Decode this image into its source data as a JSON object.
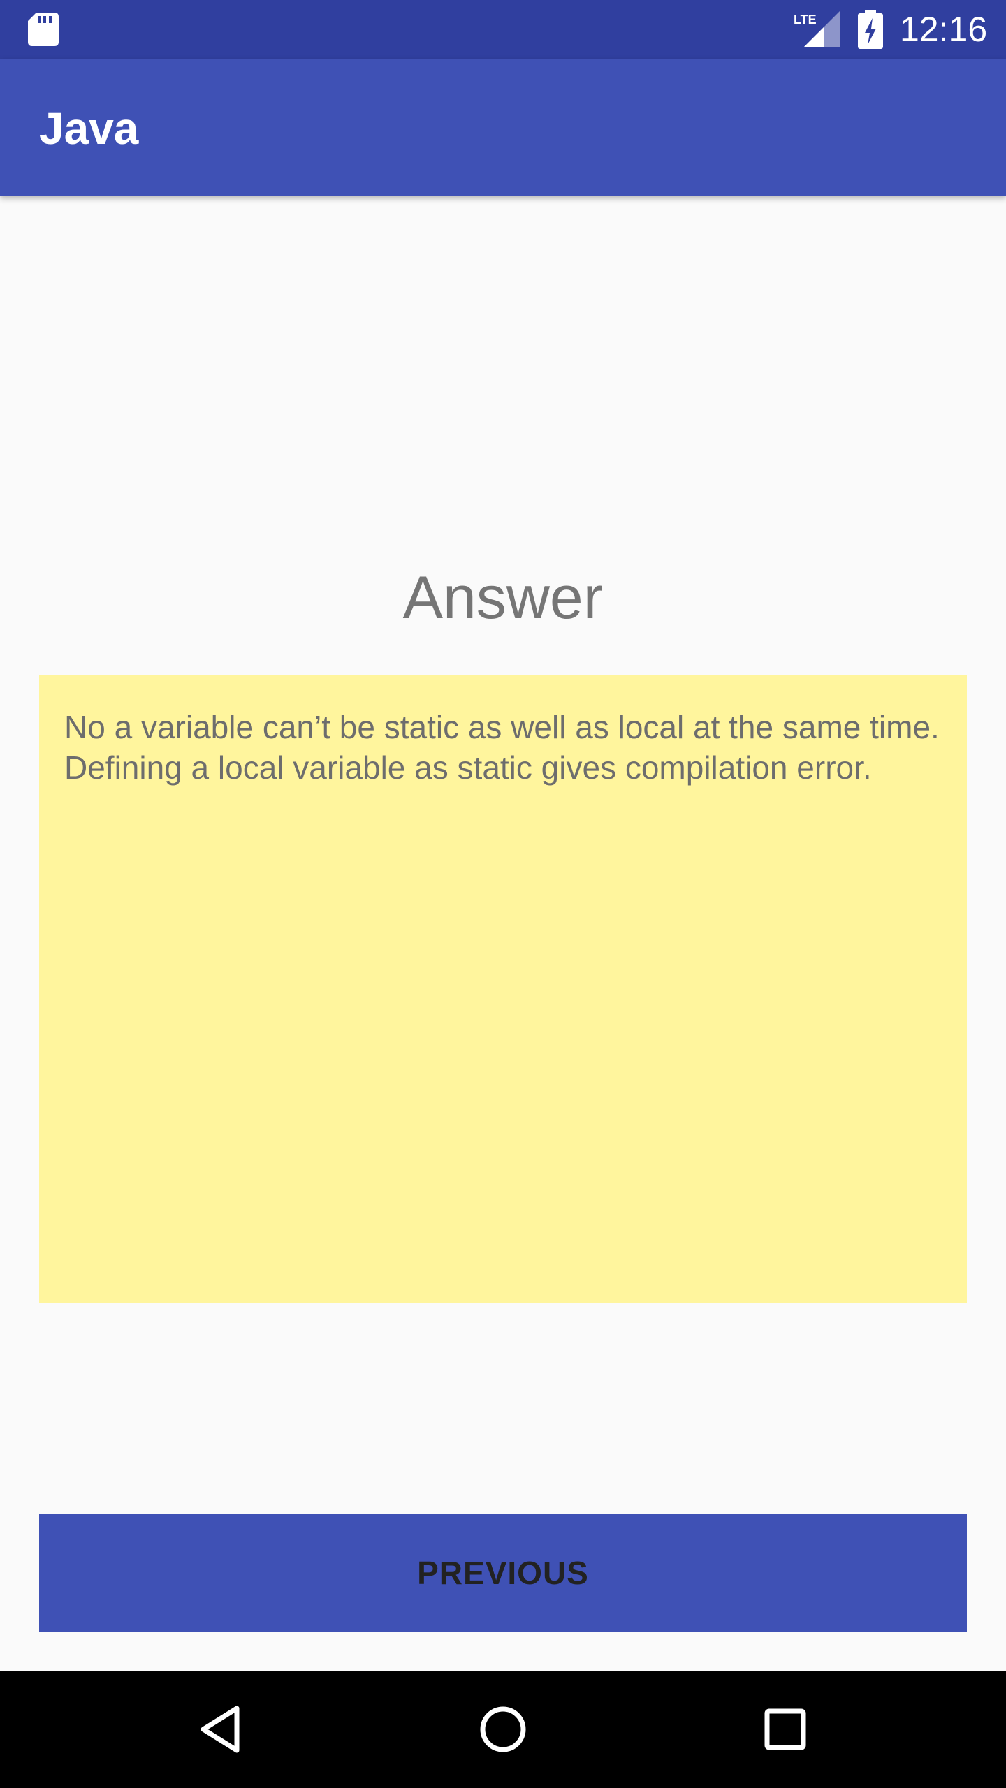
{
  "status_bar": {
    "time": "12:16",
    "network_label": "LTE",
    "icons": [
      "sd-card-icon",
      "signal-icon",
      "battery-charging-icon"
    ]
  },
  "app_bar": {
    "title": "Java"
  },
  "main": {
    "heading": "Answer",
    "answer_text": "No a variable can’t be static as well as local at the same time. Defining a local variable as static gives compilation error."
  },
  "actions": {
    "previous_label": "PREVIOUS"
  },
  "nav_bar": {
    "icons": [
      "back-icon",
      "home-icon",
      "recents-icon"
    ]
  },
  "colors": {
    "status_bar": "#303f9f",
    "app_bar": "#3f51b5",
    "answer_background": "#fff59d",
    "button_background": "#3f51b5",
    "page_background": "#fafafa"
  }
}
